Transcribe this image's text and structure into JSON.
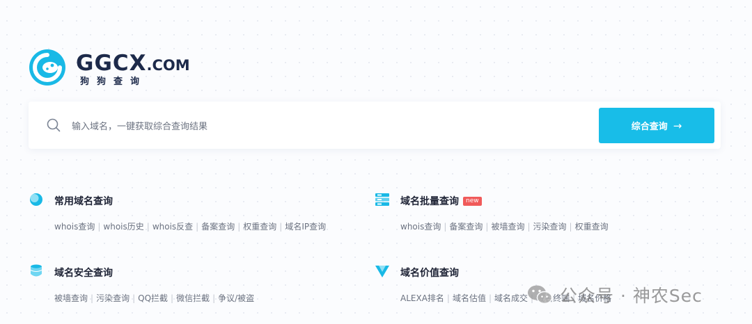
{
  "logo": {
    "word": "GGCX",
    "suffix": ".COM",
    "subtitle": "狗狗查询"
  },
  "search": {
    "placeholder": "输入域名，一键获取综合查询结果",
    "button_label": "综合查询",
    "button_arrow": "→"
  },
  "sections": [
    {
      "title": "常用域名查询",
      "badge": "",
      "links": [
        "whois查询",
        "whois历史",
        "whois反查",
        "备案查询",
        "权重查询",
        "域名IP查询"
      ]
    },
    {
      "title": "域名批量查询",
      "badge": "new",
      "links": [
        "whois查询",
        "备案查询",
        "被墙查询",
        "污染查询",
        "权重查询"
      ]
    },
    {
      "title": "域名安全查询",
      "badge": "",
      "links": [
        "被墙查询",
        "污染查询",
        "QQ拦截",
        "微信拦截",
        "争议/被盗"
      ]
    },
    {
      "title": "域名价值查询",
      "badge": "",
      "links": [
        "ALEXA排名",
        "域名估值",
        "域名成交",
        "域名终端",
        "域名价格"
      ]
    }
  ],
  "watermark": {
    "text": "公众号 · 神农Sec"
  },
  "colors": {
    "accent": "#18bde8",
    "brand_dark": "#1d2a4a",
    "badge": "#f05a5a"
  }
}
